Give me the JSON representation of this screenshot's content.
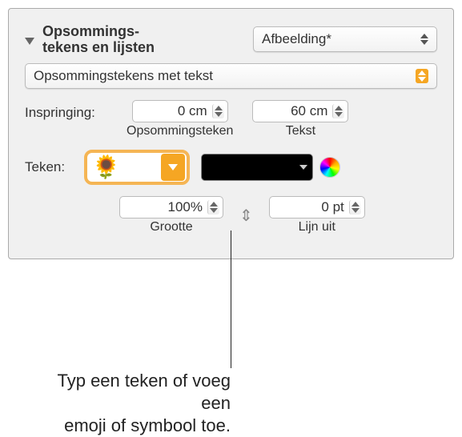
{
  "header": {
    "title_line1": "Opsommings-",
    "title_line2": "tekens en lijsten",
    "style_popup": "Afbeelding*"
  },
  "bullet_style": {
    "value": "Opsommingstekens met tekst"
  },
  "indent": {
    "label": "Inspringing:",
    "bullet": {
      "value": "0 cm",
      "caption": "Opsommingsteken"
    },
    "text": {
      "value": "60 cm",
      "caption": "Tekst"
    }
  },
  "character": {
    "label": "Teken:",
    "value": "🌻"
  },
  "size": {
    "value": "100%",
    "caption": "Grootte"
  },
  "align": {
    "value": "0 pt",
    "caption": "Lijn uit"
  },
  "callout": {
    "line1": "Typ een teken of voeg een",
    "line2": "emoji of symbool toe."
  }
}
